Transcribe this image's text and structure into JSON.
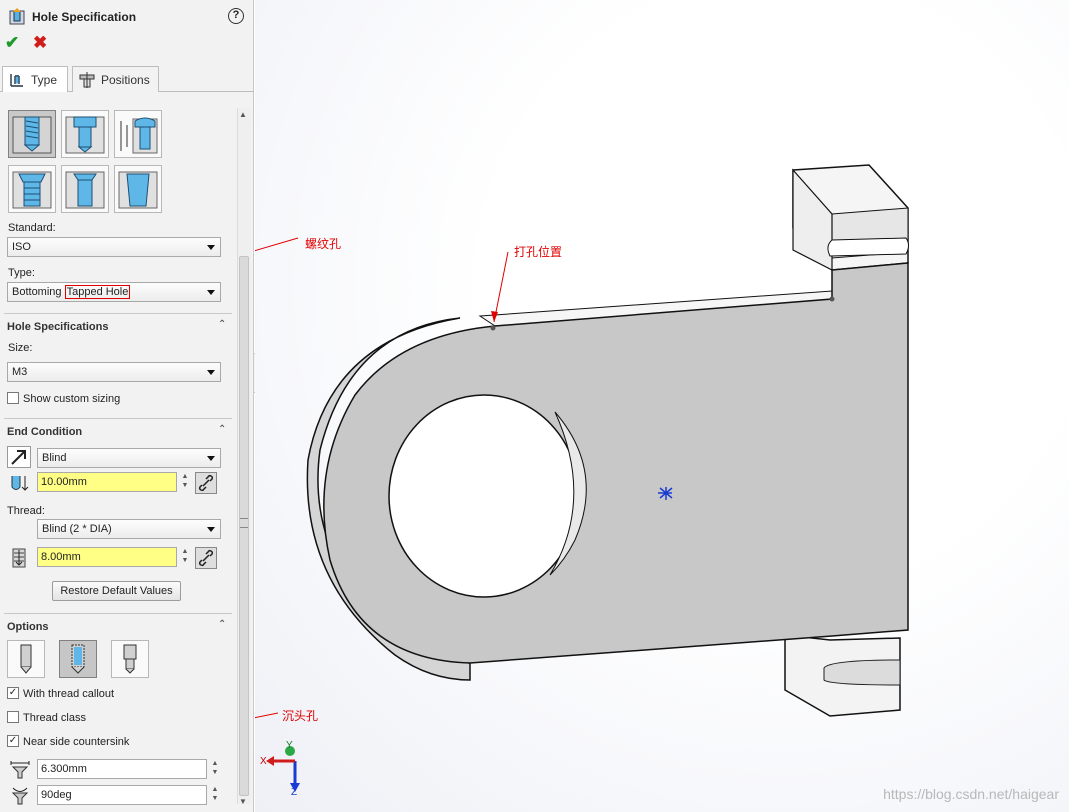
{
  "panel": {
    "title": "Hole Specification",
    "tabs": [
      {
        "label": "Type"
      },
      {
        "label": "Positions"
      }
    ],
    "standard_label": "Standard:",
    "standard_value": "ISO",
    "type_label": "Type:",
    "type_value_prefix": "Bottoming ",
    "type_value_suffix": "Tapped Hole",
    "hole_specs": {
      "header": "Hole Specifications",
      "size_label": "Size:",
      "size_value": "M3",
      "custom_sizing": "Show custom sizing"
    },
    "end_condition": {
      "header": "End Condition",
      "condition_value": "Blind",
      "depth_value": "10.00mm",
      "thread_label": "Thread:",
      "thread_value": "Blind (2 * DIA)",
      "thread_depth_value": "8.00mm",
      "restore_button": "Restore Default Values"
    },
    "options": {
      "header": "Options",
      "with_thread_callout": "With thread callout",
      "thread_class": "Thread class",
      "near_side_countersink": "Near side countersink",
      "countersink_diameter": "6.300mm",
      "countersink_angle": "90deg"
    }
  },
  "annotations": {
    "tapped_hole": "螺纹孔",
    "hole_position": "打孔位置",
    "countersink": "沉头孔"
  },
  "triad": {
    "x": "X",
    "y": "Y",
    "z": "Z"
  },
  "watermark": "https://blog.csdn.net/haigear",
  "colors": {
    "accent_red": "#e00000",
    "field_yellow": "#ffff85",
    "ok_green": "#1d9a2c",
    "part_gray": "#c8c8c8"
  }
}
